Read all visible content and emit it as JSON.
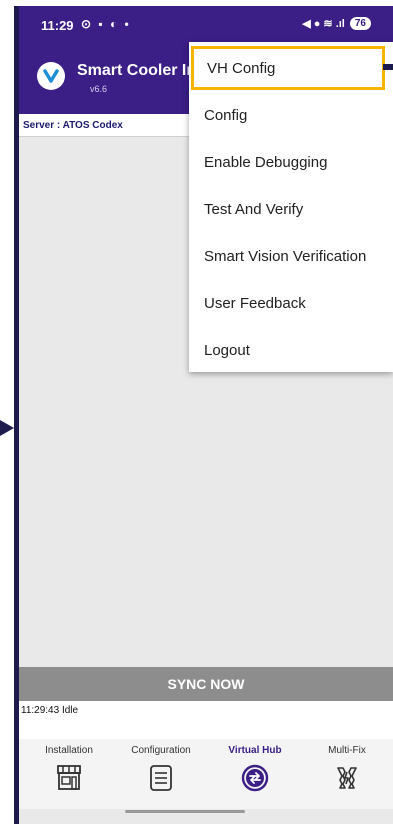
{
  "statusbar": {
    "time": "11:29",
    "left_icons": "⊙ ▪ ◐ •",
    "right_icons": "◀ ● ≋ .ıl",
    "battery": "76"
  },
  "appbar": {
    "title": "Smart Cooler Ins",
    "version": "v6.6"
  },
  "server": "Server : ATOS Codex",
  "menu": {
    "items": [
      {
        "label": "VH Config",
        "highlighted": true
      },
      {
        "label": "Config"
      },
      {
        "label": "Enable Debugging"
      },
      {
        "label": "Test And Verify"
      },
      {
        "label": "Smart Vision Verification"
      },
      {
        "label": "User Feedback"
      },
      {
        "label": "Logout"
      }
    ]
  },
  "sync_button": "SYNC NOW",
  "log_text": "11:29:43 Idle",
  "bottom_nav": {
    "items": [
      {
        "label": "Installation",
        "icon": "store-icon"
      },
      {
        "label": "Configuration",
        "icon": "list-icon"
      },
      {
        "label": "Virtual Hub",
        "icon": "sync-circle-icon",
        "active": true
      },
      {
        "label": "Multi-Fix",
        "icon": "wrench-bolt-icon"
      }
    ]
  },
  "colors": {
    "primary": "#3b1e86",
    "highlight": "#f7b500",
    "sync_button": "#8d8d8d",
    "frame": "#1d1a4e"
  }
}
